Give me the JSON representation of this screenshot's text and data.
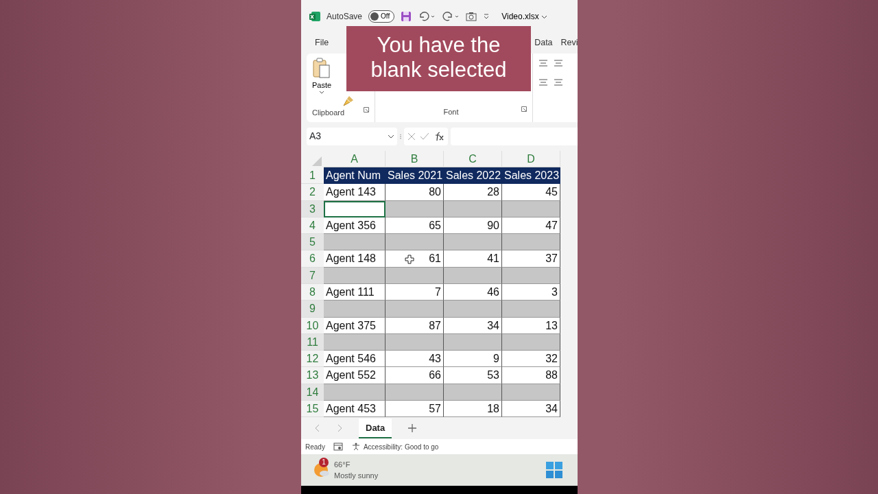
{
  "title_bar": {
    "autosave_label": "AutoSave",
    "autosave": {
      "on": false,
      "label": "Off"
    },
    "file_name": "Video.xlsx"
  },
  "ribbon_tabs": [
    {
      "label": "File"
    },
    {
      "label": "Data"
    },
    {
      "label": "Revi"
    }
  ],
  "caption": "You have the\nblank selected",
  "ribbon": {
    "paste_label": "Paste",
    "groups": [
      "Clipboard",
      "Font"
    ]
  },
  "formula_bar": {
    "name_box": "A3"
  },
  "sheet": {
    "columns": [
      "A",
      "B",
      "C",
      "D"
    ],
    "rows": [
      {
        "number": "1",
        "kind": "header",
        "selected": false,
        "cells": [
          "Agent Num",
          "Sales 2021",
          "Sales 2022",
          "Sales 2023"
        ]
      },
      {
        "number": "2",
        "kind": "data",
        "selected": false,
        "cells": [
          "Agent 143",
          "80",
          "28",
          "45"
        ]
      },
      {
        "number": "3",
        "kind": "blank",
        "selected": true,
        "active": true
      },
      {
        "number": "4",
        "kind": "data",
        "selected": false,
        "cells": [
          "Agent 356",
          "65",
          "90",
          "47"
        ]
      },
      {
        "number": "5",
        "kind": "blank",
        "selected": true
      },
      {
        "number": "6",
        "kind": "data",
        "selected": false,
        "cells": [
          "Agent 148",
          "61",
          "41",
          "37"
        ]
      },
      {
        "number": "7",
        "kind": "blank",
        "selected": true
      },
      {
        "number": "8",
        "kind": "data",
        "selected": false,
        "cells": [
          "Agent 111",
          "7",
          "46",
          "3"
        ]
      },
      {
        "number": "9",
        "kind": "blank",
        "selected": true
      },
      {
        "number": "10",
        "kind": "data",
        "selected": false,
        "cells": [
          "Agent 375",
          "87",
          "34",
          "13"
        ]
      },
      {
        "number": "11",
        "kind": "blank",
        "selected": true
      },
      {
        "number": "12",
        "kind": "data",
        "selected": false,
        "cells": [
          "Agent 546",
          "43",
          "9",
          "32"
        ]
      },
      {
        "number": "13",
        "kind": "data",
        "selected": false,
        "cells": [
          "Agent 552",
          "66",
          "53",
          "88"
        ]
      },
      {
        "number": "14",
        "kind": "blank",
        "selected": true
      },
      {
        "number": "15",
        "kind": "data",
        "selected": false,
        "cells": [
          "Agent 453",
          "57",
          "18",
          "34"
        ]
      }
    ]
  },
  "sheet_tabs": [
    {
      "label": "Data",
      "selected": true
    }
  ],
  "status_bar": {
    "ready": "Ready",
    "accessibility": "Accessibility: Good to go"
  },
  "taskbar": {
    "badge": "1",
    "temperature": "66°F",
    "condition": "Mostly sunny"
  }
}
